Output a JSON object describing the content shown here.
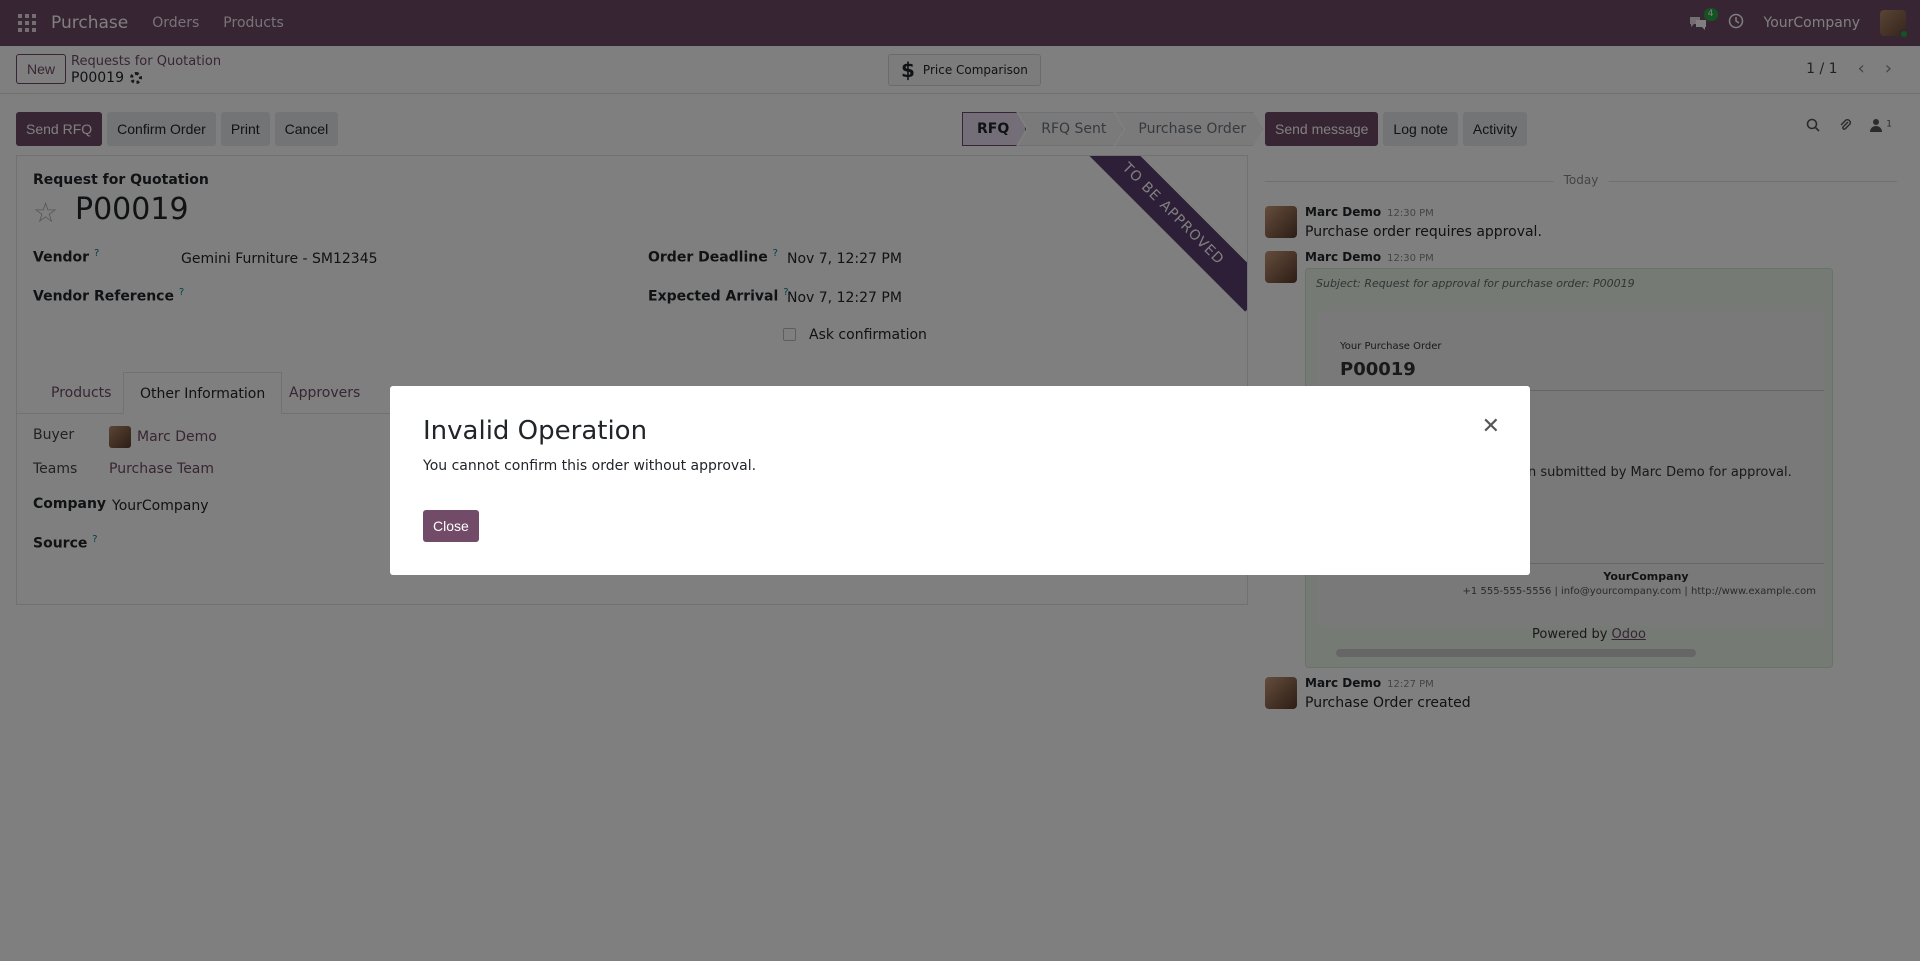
{
  "navbar": {
    "app_name": "Purchase",
    "menu": [
      "Orders",
      "Products"
    ],
    "notification_count": "4",
    "company": "YourCompany"
  },
  "control": {
    "new_label": "New",
    "breadcrumb": "Requests for Quotation",
    "record": "P00019",
    "price_comparison": "Price Comparison",
    "price_icon": "$",
    "pager": "1 / 1"
  },
  "actions": {
    "send_rfq": "Send RFQ",
    "confirm_order": "Confirm Order",
    "print": "Print",
    "cancel": "Cancel"
  },
  "status_steps": [
    "RFQ",
    "RFQ Sent",
    "Purchase Order"
  ],
  "form": {
    "subtitle": "Request for Quotation",
    "title": "P00019",
    "ribbon": "TO BE APPROVED",
    "vendor_label": "Vendor",
    "vendor_value": "Gemini Furniture - SM12345",
    "vendor_ref_label": "Vendor Reference",
    "order_deadline_label": "Order Deadline",
    "order_deadline_value": "Nov 7, 12:27 PM",
    "expected_arrival_label": "Expected Arrival",
    "expected_arrival_value": "Nov 7, 12:27 PM",
    "ask_confirmation": "Ask confirmation",
    "help_mark": "?",
    "tabs": [
      "Products",
      "Other Information",
      "Approvers"
    ],
    "buyer_label": "Buyer",
    "buyer_value": "Marc Demo",
    "teams_label": "Teams",
    "teams_value": "Purchase Team",
    "company_label": "Company",
    "company_value": "YourCompany",
    "source_label": "Source"
  },
  "chatter": {
    "send_message": "Send message",
    "log_note": "Log note",
    "activity": "Activity",
    "followers_count": "1",
    "today": "Today",
    "messages": [
      {
        "author": "Marc Demo",
        "time": "12:30 PM",
        "body": "Purchase order requires approval."
      },
      {
        "author": "Marc Demo",
        "time": "12:30 PM",
        "body": ""
      },
      {
        "author": "Marc Demo",
        "time": "12:27 PM",
        "body": "Purchase Order created"
      }
    ],
    "email": {
      "subject": "Subject: Request for approval for purchase order: P00019",
      "po_label": "Your Purchase Order",
      "po_number": "P00019",
      "submitted_text": "een submitted by Marc Demo for approval.",
      "company": "YourCompany",
      "contact": "+1 555-555-5556 | info@yourcompany.com | http://www.example.com",
      "powered_prefix": "Powered by ",
      "powered_link": "Odoo"
    }
  },
  "dialog": {
    "title": "Invalid Operation",
    "message": "You cannot confirm this order without approval.",
    "close_label": "Close",
    "close_icon": "✕"
  },
  "colors": {
    "brand": "#714b67",
    "ribbon": "#5d3f73",
    "online": "#28a745"
  }
}
